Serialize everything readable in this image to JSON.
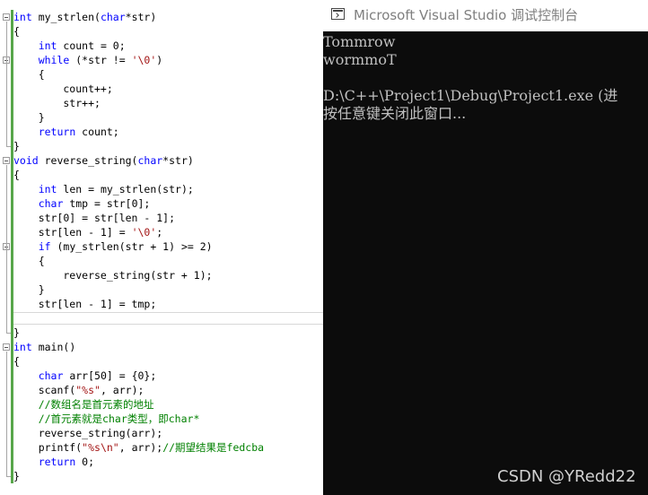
{
  "editor": {
    "lines": [
      {
        "parts": [
          {
            "t": "int",
            "c": "kw"
          },
          {
            "t": " my_strlen("
          },
          {
            "t": "char",
            "c": "kw"
          },
          {
            "t": "*str)"
          }
        ]
      },
      {
        "parts": [
          {
            "t": "{"
          }
        ]
      },
      {
        "parts": [
          {
            "t": "    "
          },
          {
            "t": "int",
            "c": "kw"
          },
          {
            "t": " count = 0;"
          }
        ]
      },
      {
        "parts": [
          {
            "t": "    "
          },
          {
            "t": "while",
            "c": "kw"
          },
          {
            "t": " (*str != "
          },
          {
            "t": "'\\0'",
            "c": "str"
          },
          {
            "t": ")"
          }
        ]
      },
      {
        "parts": [
          {
            "t": "    {"
          }
        ]
      },
      {
        "parts": [
          {
            "t": "        count++;"
          }
        ]
      },
      {
        "parts": [
          {
            "t": "        str++;"
          }
        ]
      },
      {
        "parts": [
          {
            "t": "    }"
          }
        ]
      },
      {
        "parts": [
          {
            "t": "    "
          },
          {
            "t": "return",
            "c": "kw"
          },
          {
            "t": " count;"
          }
        ]
      },
      {
        "parts": [
          {
            "t": "}"
          }
        ]
      },
      {
        "parts": [
          {
            "t": "void",
            "c": "kw"
          },
          {
            "t": " reverse_string("
          },
          {
            "t": "char",
            "c": "kw"
          },
          {
            "t": "*str)"
          }
        ]
      },
      {
        "parts": [
          {
            "t": "{"
          }
        ]
      },
      {
        "parts": [
          {
            "t": "    "
          },
          {
            "t": "int",
            "c": "kw"
          },
          {
            "t": " len = my_strlen(str);"
          }
        ]
      },
      {
        "parts": [
          {
            "t": "    "
          },
          {
            "t": "char",
            "c": "kw"
          },
          {
            "t": " tmp = str[0];"
          }
        ]
      },
      {
        "parts": [
          {
            "t": "    str[0] = str[len - 1];"
          }
        ]
      },
      {
        "parts": [
          {
            "t": "    str[len - 1] = "
          },
          {
            "t": "'\\0'",
            "c": "str"
          },
          {
            "t": ";"
          }
        ]
      },
      {
        "parts": [
          {
            "t": "    "
          },
          {
            "t": "if",
            "c": "kw"
          },
          {
            "t": " (my_strlen(str + 1) >= 2)"
          }
        ]
      },
      {
        "parts": [
          {
            "t": "    {"
          }
        ]
      },
      {
        "parts": [
          {
            "t": "        reverse_string(str + 1);"
          }
        ]
      },
      {
        "parts": [
          {
            "t": "    }"
          }
        ]
      },
      {
        "parts": [
          {
            "t": "    str[len - 1] = tmp;"
          }
        ]
      },
      {
        "parts": [
          {
            "t": ""
          }
        ]
      },
      {
        "parts": [
          {
            "t": "}"
          }
        ]
      },
      {
        "parts": [
          {
            "t": "int",
            "c": "kw"
          },
          {
            "t": " main()"
          }
        ]
      },
      {
        "parts": [
          {
            "t": "{"
          }
        ]
      },
      {
        "parts": [
          {
            "t": "    "
          },
          {
            "t": "char",
            "c": "kw"
          },
          {
            "t": " arr[50] = {0};"
          }
        ]
      },
      {
        "parts": [
          {
            "t": "    scanf("
          },
          {
            "t": "\"%s\"",
            "c": "str"
          },
          {
            "t": ", arr);"
          }
        ]
      },
      {
        "parts": [
          {
            "t": "    "
          },
          {
            "t": "//数组名是首元素的地址",
            "c": "cm"
          }
        ]
      },
      {
        "parts": [
          {
            "t": "    "
          },
          {
            "t": "//首元素就是char类型，即char*",
            "c": "cm"
          }
        ]
      },
      {
        "parts": [
          {
            "t": "    reverse_string(arr);"
          }
        ]
      },
      {
        "parts": [
          {
            "t": "    printf("
          },
          {
            "t": "\"%s\\n\"",
            "c": "str"
          },
          {
            "t": ", arr);"
          },
          {
            "t": "//期望结果是fedcba",
            "c": "cm"
          }
        ]
      },
      {
        "parts": [
          {
            "t": "    "
          },
          {
            "t": "return",
            "c": "kw"
          },
          {
            "t": " 0;"
          }
        ]
      },
      {
        "parts": [
          {
            "t": "}"
          }
        ]
      }
    ]
  },
  "console": {
    "title": "Microsoft Visual Studio 调试控制台",
    "lines": [
      "Tommrow",
      "wormmoT",
      "",
      "D:\\C++\\Project1\\Debug\\Project1.exe (进",
      "按任意键关闭此窗口..."
    ]
  },
  "watermark": "CSDN @YRedd22",
  "colors": {
    "keyword": "#0000ff",
    "string": "#a31515",
    "comment": "#008000",
    "console_bg": "#0c0c0c",
    "console_text": "#c0c0c0",
    "change_bar": "#57a64a"
  }
}
